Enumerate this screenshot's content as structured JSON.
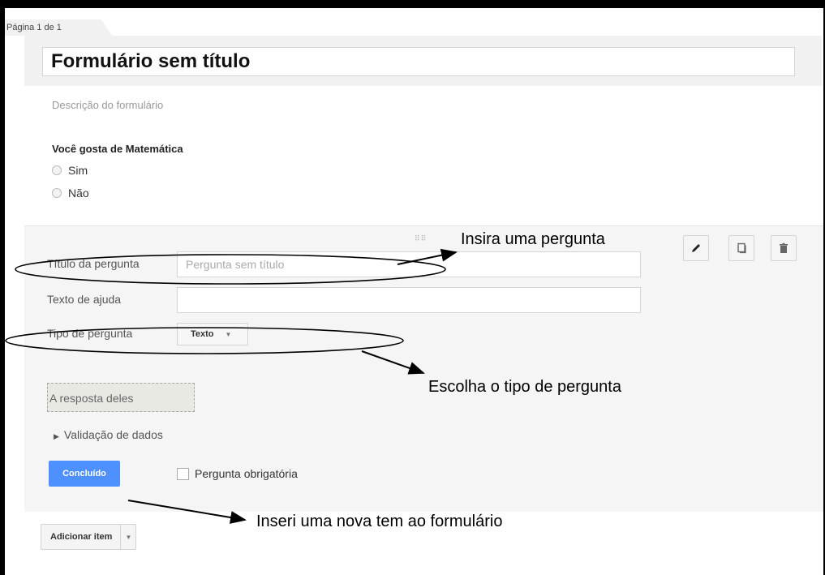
{
  "page_indicator": "Página 1 de 1",
  "form": {
    "title": "Formulário sem título",
    "description_placeholder": "Descrição do formulário"
  },
  "question": {
    "title": "Você gosta de Matemática",
    "options": [
      "Sim",
      "Não"
    ]
  },
  "editor": {
    "drag_handle": "⠿⠿",
    "title_label": "Título da pergunta",
    "title_placeholder": "Pergunta sem título",
    "help_label": "Texto de ajuda",
    "help_value": "",
    "type_label": "Tipo de pergunta",
    "type_selected": "Texto",
    "answer_preview": "A resposta deles",
    "validation_label": "Validação de dados",
    "done_button": "Concluído",
    "required_label": "Pergunta obrigatória",
    "icons": [
      "pencil-icon",
      "duplicate-icon",
      "trash-icon"
    ]
  },
  "footer": {
    "add_item_button": "Adicionar item"
  },
  "annotations": {
    "insert_question": "Insira uma pergunta",
    "choose_type": "Escolha o tipo de pergunta",
    "insert_item": "Inseri uma nova tem ao formulário"
  },
  "colors": {
    "accent_blue": "#4d90fe",
    "panel_bg": "#f5f5f5"
  }
}
